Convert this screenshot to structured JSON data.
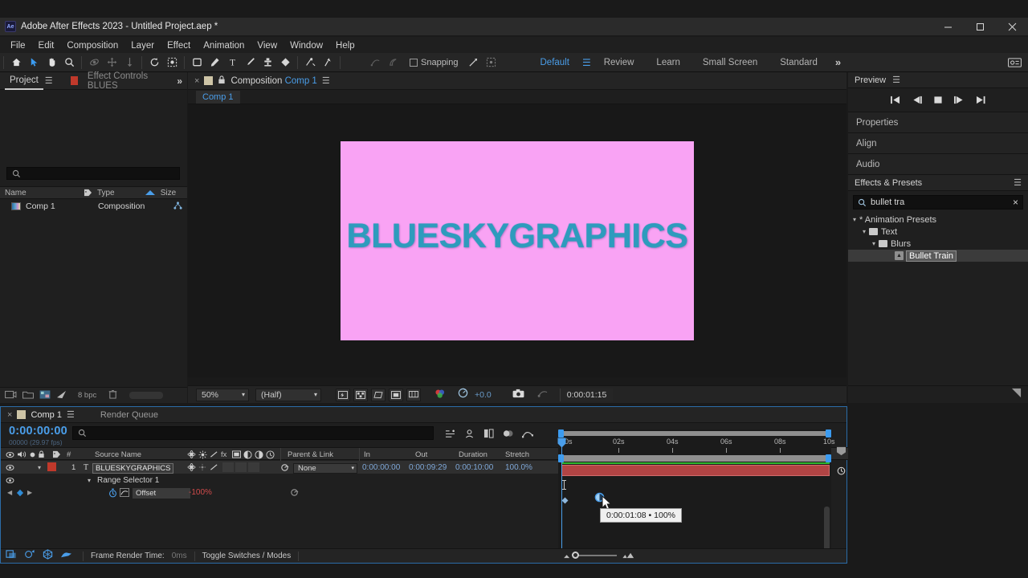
{
  "window": {
    "title": "Adobe After Effects 2023 - Untitled Project.aep *",
    "app_icon": "Ae",
    "controls": {
      "minimize": "minimize-icon",
      "maximize": "maximize-icon",
      "close": "close-icon"
    }
  },
  "menu": {
    "items": [
      "File",
      "Edit",
      "Composition",
      "Layer",
      "Effect",
      "Animation",
      "View",
      "Window",
      "Help"
    ]
  },
  "toolbar": {
    "tools": [
      {
        "name": "home-icon",
        "glyph": "⌂",
        "state": "normal"
      },
      {
        "name": "selection-tool-icon",
        "glyph": "➤",
        "state": "selected"
      },
      {
        "name": "hand-tool-icon",
        "glyph": "✋",
        "state": "normal"
      },
      {
        "name": "zoom-tool-icon",
        "glyph": "⌕",
        "state": "normal"
      },
      {
        "name": "orbit-tool-icon",
        "glyph": "◌",
        "state": "dim"
      },
      {
        "name": "pan-behind-tool-icon",
        "glyph": "✥",
        "state": "dim"
      },
      {
        "name": "dolly-tool-icon",
        "glyph": "↓",
        "state": "dim"
      },
      {
        "name": "rotation-tool-icon",
        "glyph": "↺",
        "state": "normal"
      },
      {
        "name": "roto-brush-tool-icon",
        "glyph": "⬚",
        "state": "normal"
      },
      {
        "name": "shape-tool-icon",
        "glyph": "■",
        "state": "normal"
      },
      {
        "name": "pen-tool-icon",
        "glyph": "✒",
        "state": "normal"
      },
      {
        "name": "type-tool-icon",
        "glyph": "T",
        "state": "normal"
      },
      {
        "name": "brush-tool-icon",
        "glyph": "╱",
        "state": "normal"
      },
      {
        "name": "clone-stamp-tool-icon",
        "glyph": "⚓",
        "state": "normal"
      },
      {
        "name": "eraser-tool-icon",
        "glyph": "◆",
        "state": "normal"
      },
      {
        "name": "puppet-pin-tool-icon",
        "glyph": "✦",
        "state": "normal"
      },
      {
        "name": "puppet-starch-tool-icon",
        "glyph": "✷",
        "state": "normal"
      }
    ],
    "snapping_label": "Snapping",
    "snapping_checked": false
  },
  "workspaces": {
    "items": [
      {
        "label": "Default",
        "active": true
      },
      {
        "label": "Review",
        "active": false
      },
      {
        "label": "Learn",
        "active": false
      },
      {
        "label": "Small Screen",
        "active": false
      },
      {
        "label": "Standard",
        "active": false
      }
    ],
    "overflow": "»"
  },
  "project_panel": {
    "tabs": [
      {
        "label": "Project",
        "active": true
      },
      {
        "label": "Effect Controls BLUES",
        "active": false
      }
    ],
    "overflow": "»",
    "search_placeholder": "",
    "columns": [
      "Name",
      "Type",
      "Size"
    ],
    "rows": [
      {
        "name": "Comp 1",
        "type": "Composition",
        "size": ""
      }
    ],
    "bit_depth": "8 bpc"
  },
  "comp_panel": {
    "close_label": "×",
    "title_prefix": "Composition",
    "title_name": "Comp 1",
    "subtab": "Comp 1",
    "canvas_text": "BLUESKYGRAPHICS",
    "canvas_bg": "#f9a3f4",
    "canvas_text_color": "#2e9bbd",
    "footer": {
      "magnification": "50%",
      "resolution": "(Half)",
      "exposure": "+0.0",
      "timecode": "0:00:01:15"
    }
  },
  "right_panel": {
    "preview": {
      "title": "Preview",
      "transport": [
        "first-frame-icon",
        "prev-frame-icon",
        "stop-icon",
        "next-frame-icon",
        "last-frame-icon"
      ]
    },
    "collapsed": [
      "Properties",
      "Align",
      "Audio"
    ],
    "effects_presets": {
      "title": "Effects & Presets",
      "search_value": "bullet tra",
      "clear_label": "×",
      "tree": [
        {
          "label": "* Animation Presets",
          "depth": 0,
          "type": "root",
          "expanded": true
        },
        {
          "label": "Text",
          "depth": 1,
          "type": "folder",
          "expanded": true
        },
        {
          "label": "Blurs",
          "depth": 2,
          "type": "folder",
          "expanded": true
        },
        {
          "label": "Bullet Train",
          "depth": 3,
          "type": "preset",
          "selected": true
        }
      ]
    }
  },
  "timeline": {
    "tabs": [
      {
        "label": "Comp 1",
        "active": true
      },
      {
        "label": "Render Queue",
        "active": false
      }
    ],
    "current_time": "0:00:00:00",
    "frame_info": "00000 (29.97 fps)",
    "search_placeholder": "",
    "columns": [
      "#",
      "Source Name",
      "Parent & Link",
      "In",
      "Out",
      "Duration",
      "Stretch"
    ],
    "layer": {
      "index": "1",
      "type_icon": "T",
      "name": "BLUESKYGRAPHICS",
      "parent": "None",
      "in": "0:00:00:00",
      "out": "0:00:09:29",
      "duration": "0:00:10:00",
      "stretch": "100.0%"
    },
    "property_rows": [
      {
        "label": "Range Selector 1",
        "value": "",
        "indent": 1
      },
      {
        "label": "Offset",
        "value": "-100",
        "unit": "%",
        "indent": 2
      }
    ],
    "ruler_labels": [
      "00s",
      "02s",
      "04s",
      "06s",
      "08s",
      "10s"
    ],
    "keyframe_tooltip": "0:00:01:08 • 100%",
    "zoom_slider_value": 25,
    "footer": {
      "render_time_label": "Frame Render Time:",
      "render_time_value": "0ms",
      "toggle_label": "Toggle Switches / Modes"
    }
  }
}
